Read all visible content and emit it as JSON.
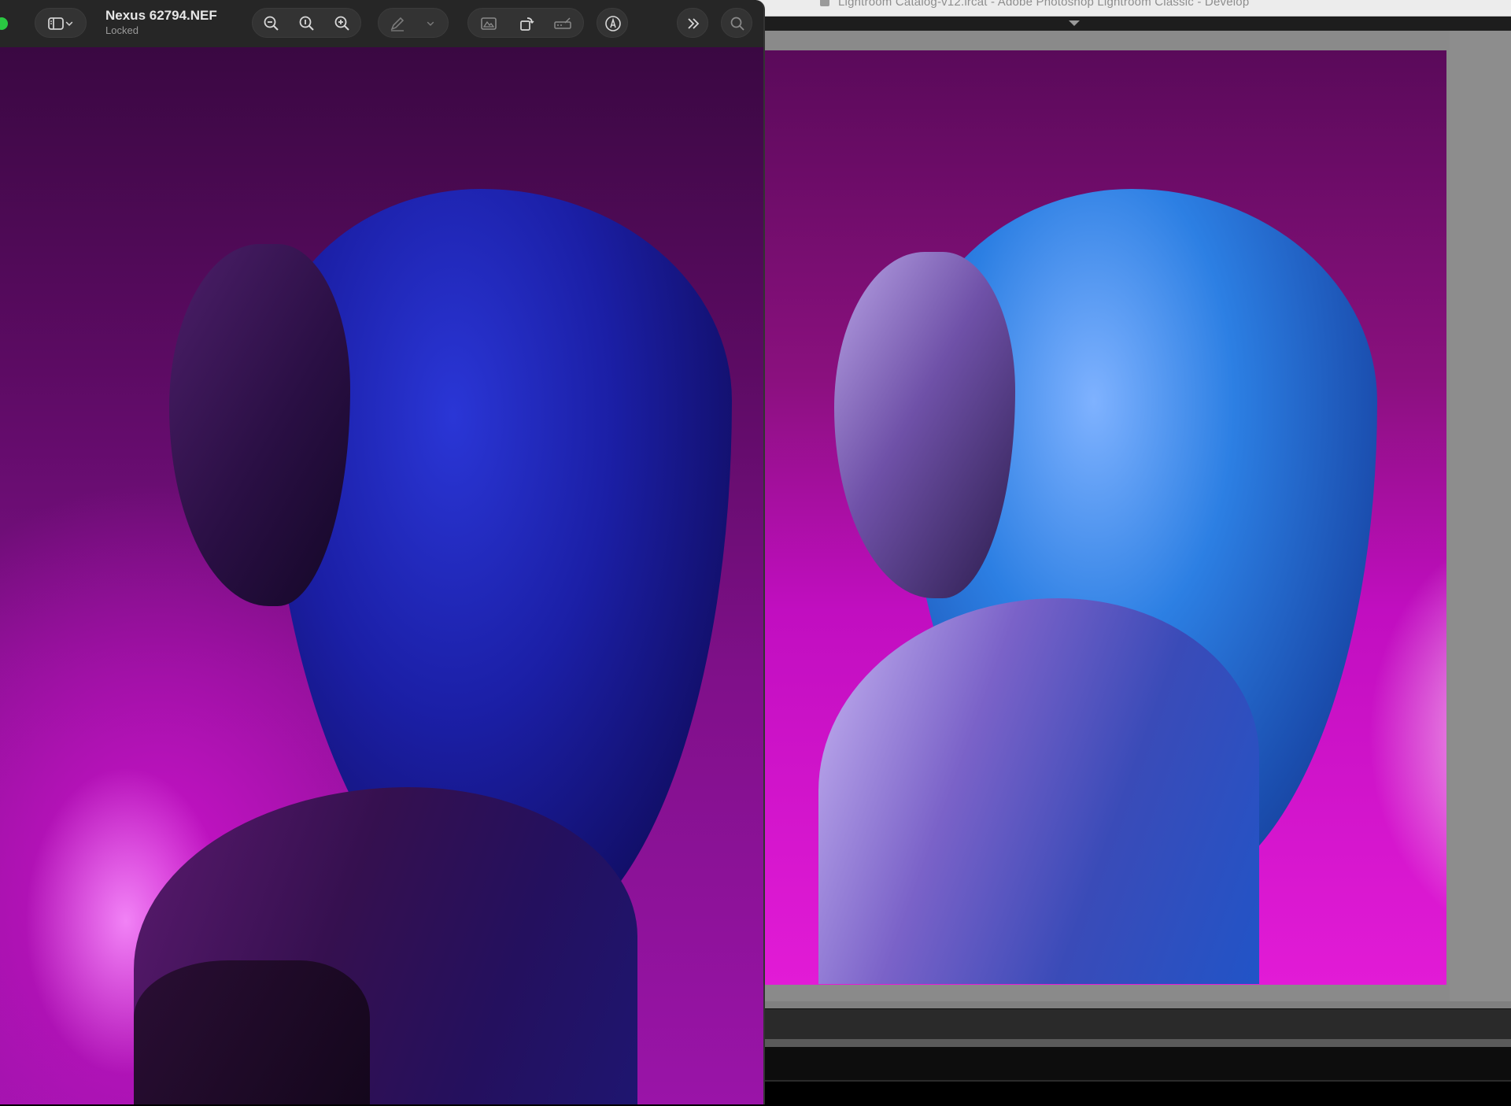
{
  "lightroom": {
    "window_title": "Lightroom Catalog-v12.lrcat - Adobe Photoshop Lightroom Classic - Develop"
  },
  "preview": {
    "document": {
      "name": "Nexus 62794.NEF",
      "status": "Locked"
    },
    "toolbar": {
      "icons": [
        "sidebar-icon",
        "chevron-down-icon",
        "zoom-out-icon",
        "actual-size-icon",
        "zoom-in-icon",
        "markup-pen-icon",
        "chevron-down-icon",
        "adjust-icon",
        "rotate-icon",
        "sign-icon",
        "annotate-icon",
        "more-icon",
        "search-icon"
      ]
    }
  },
  "colors": {
    "window_close_green": "#2ac842",
    "toolbar_bg": "#262626",
    "lightroom_titlebar": "#ececec"
  }
}
